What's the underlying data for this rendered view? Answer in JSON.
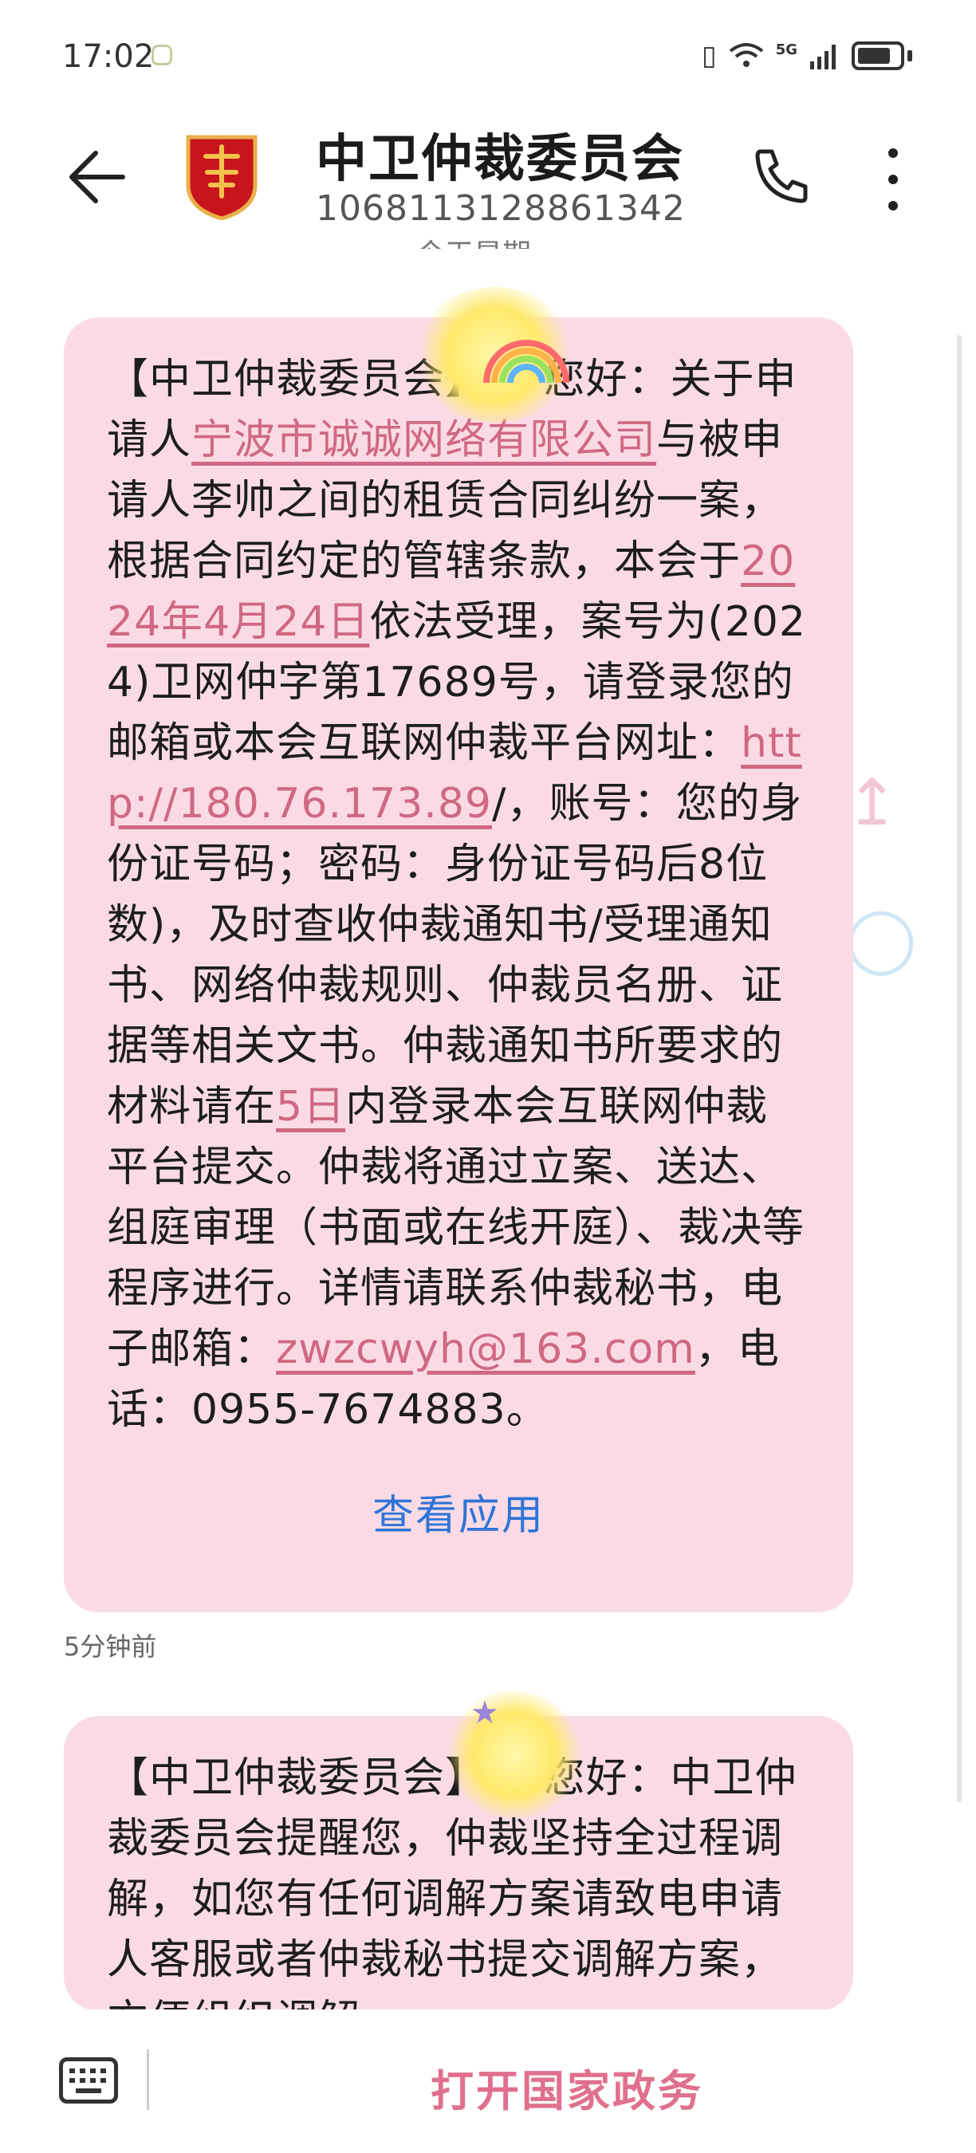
{
  "status_bar": {
    "time": "17:02",
    "signal_label": "5G",
    "icons": [
      "vibrate-icon",
      "wifi-icon",
      "signal-icon",
      "battery-icon"
    ]
  },
  "header": {
    "title": "中卫仲裁委员会",
    "subtitle": "1068113128861342",
    "avatar_icon": "government-badge-icon",
    "day_divider": "今天星期一"
  },
  "messages": [
    {
      "parts": [
        {
          "t": "【中卫仲裁委员会】"
        },
        {
          "t": "        "
        },
        {
          "t": "，您好：关于申请人"
        },
        {
          "t": "宁波市诚诚网络有限公司",
          "link": true
        },
        {
          "t": "与被申请人李帅之间的租赁合同纠纷一案，根据合同约定的管辖条款，本会于"
        },
        {
          "t": "2024年4月24日",
          "link": true
        },
        {
          "t": "依法受理，案号为(2024)卫网仲字第17689号，请登录您的邮箱或本会互联网仲裁平台网址："
        },
        {
          "t": "http://180.76.173.89",
          "link": true
        },
        {
          "t": "/，账号：您的身份证号码；密码：身份证号码后8位数)，及时查收仲裁通知书/受理通知书、网络仲裁规则、仲裁员名册、证据等相关文书。仲裁通知书所要求的材料请在"
        },
        {
          "t": "5日",
          "link": true
        },
        {
          "t": "内登录本会互联网仲裁平台提交。仲裁将通过立案、送达、组庭审理（书面或在线开庭）、裁决等程序进行。详情请联系仲裁秘书，电子邮箱："
        },
        {
          "t": "zwzcwyh@163.com",
          "link": true
        },
        {
          "t": "，电话：0955-7674883。"
        }
      ],
      "action": "查看应用",
      "time": "5分钟前"
    },
    {
      "parts": [
        {
          "t": "【中卫仲裁委员会】"
        },
        {
          "t": "        "
        },
        {
          "t": "，您好：中卫仲裁委员会提醒您，仲裁坚持全过程调解，如您有任何调解方案请致电申请人客服或者仲裁秘书提交调解方案，方便组织调解。"
        }
      ]
    }
  ],
  "bottom_bar": {
    "open_button": "打开国家政务",
    "keyboard_icon": "keyboard-icon"
  }
}
